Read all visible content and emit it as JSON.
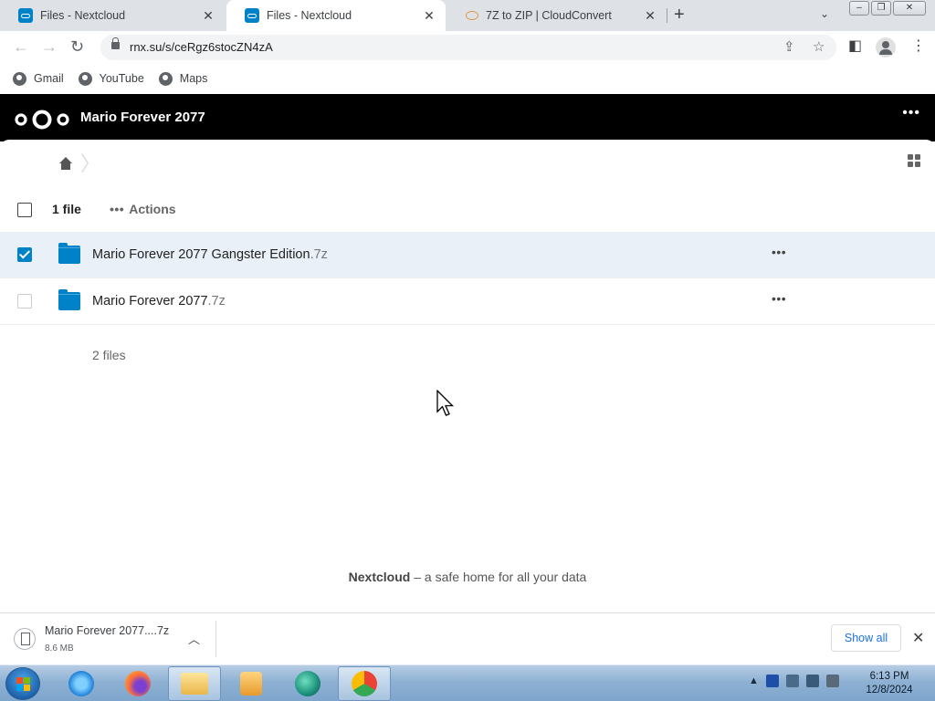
{
  "browser": {
    "tabs": [
      {
        "title": "Files - Nextcloud",
        "active": false
      },
      {
        "title": "Files - Nextcloud",
        "active": true
      },
      {
        "title": "7Z to ZIP | CloudConvert",
        "active": false
      }
    ],
    "url": "rnx.su/s/ceRgz6stocZN4zA",
    "bookmarks": [
      "Gmail",
      "YouTube",
      "Maps"
    ]
  },
  "nextcloud": {
    "share_title": "Mario Forever 2077",
    "header_menu": "•••",
    "list_header": {
      "count_label": "1 file",
      "actions_label": "Actions",
      "actions_dots": "•••"
    },
    "files": [
      {
        "base": "Mario Forever 2077 Gangster Edition",
        "ext": ".7z",
        "selected": true
      },
      {
        "base": "Mario Forever 2077",
        "ext": ".7z",
        "selected": false
      }
    ],
    "row_menu": "•••",
    "summary": "2 files",
    "footer": {
      "brand": "Nextcloud",
      "tagline": "– a safe home for all your data"
    }
  },
  "download_bar": {
    "file_name": "Mario Forever 2077....7z",
    "file_size": "8.6 MB",
    "show_all": "Show all"
  },
  "taskbar": {
    "time": "6:13 PM",
    "date": "12/8/2024",
    "tray_arrow": "▲"
  },
  "colors": {
    "nextcloud_blue": "#0082c9",
    "header_bg": "#000000",
    "selected_row": "#e9f0f8",
    "link_blue": "#1a73e8"
  },
  "icons": {
    "back": "arrow-left-icon",
    "forward": "arrow-right-icon",
    "reload": "reload-icon",
    "home": "home-icon",
    "grid_view": "grid-icon",
    "folder": "folder-icon"
  }
}
